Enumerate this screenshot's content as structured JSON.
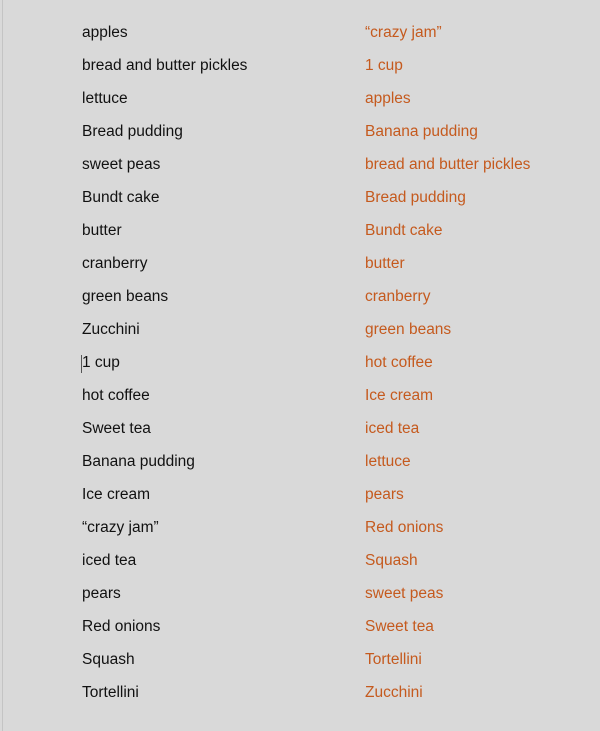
{
  "document": {
    "text_color": "#111111",
    "sorted_color": "#c55a1e",
    "original_list": [
      "apples",
      "bread and butter pickles",
      "lettuce",
      "Bread pudding",
      "sweet peas",
      "Bundt cake",
      "butter",
      "cranberry",
      "green beans",
      "Zucchini",
      "1 cup",
      "hot coffee",
      "Sweet tea",
      "Banana pudding",
      "Ice cream",
      "“crazy jam”",
      "iced tea",
      "pears",
      "Red onions",
      "Squash",
      "Tortellini"
    ],
    "sorted_list": [
      "“crazy jam”",
      "1 cup",
      "apples",
      "Banana pudding",
      "bread and butter pickles",
      "Bread pudding",
      "Bundt cake",
      "butter",
      "cranberry",
      "green beans",
      "hot coffee",
      "Ice cream",
      "iced tea",
      "lettuce",
      "pears",
      "Red onions",
      "Squash",
      "sweet peas",
      "Sweet tea",
      "Tortellini",
      "Zucchini"
    ],
    "cursor_row": 10
  }
}
